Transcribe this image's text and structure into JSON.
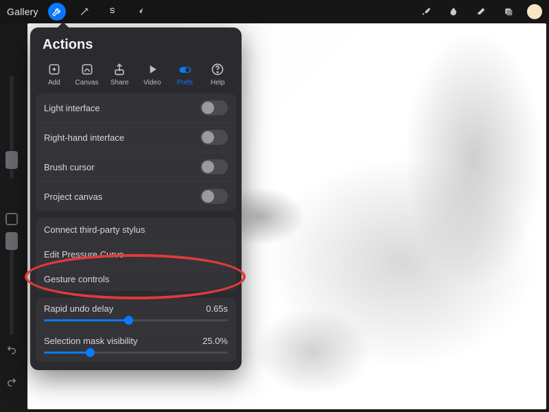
{
  "topbar": {
    "gallery_label": "Gallery"
  },
  "popover": {
    "title": "Actions",
    "tabs": [
      {
        "label": "Add"
      },
      {
        "label": "Canvas"
      },
      {
        "label": "Share"
      },
      {
        "label": "Video"
      },
      {
        "label": "Prefs",
        "active": true
      },
      {
        "label": "Help"
      }
    ],
    "toggles": [
      {
        "label": "Light interface",
        "on": false
      },
      {
        "label": "Right-hand interface",
        "on": false
      },
      {
        "label": "Brush cursor",
        "on": false
      },
      {
        "label": "Project canvas",
        "on": false
      }
    ],
    "links": [
      {
        "label": "Connect third-party stylus"
      },
      {
        "label": "Edit Pressure Curve"
      },
      {
        "label": "Gesture controls"
      }
    ],
    "sliders": [
      {
        "label": "Rapid undo delay",
        "value_text": "0.65s",
        "fill_pct": 46
      },
      {
        "label": "Selection mask visibility",
        "value_text": "25.0%",
        "fill_pct": 25
      }
    ]
  },
  "annotation": {
    "target": "gesture-controls"
  }
}
